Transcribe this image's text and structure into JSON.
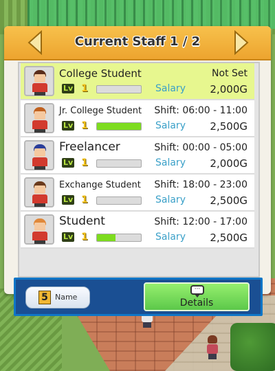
{
  "header": {
    "title": "Current Staff 1 / 2",
    "prev_icon": "arrow-left-icon",
    "next_icon": "arrow-right-icon"
  },
  "labels": {
    "lv": "Lv",
    "salary": "Salary"
  },
  "staff": [
    {
      "name": "College Student",
      "shift": "Not Set",
      "level": "1",
      "progress": 0.0,
      "salary": "2,000G",
      "hair": "#5a2c1a",
      "selected": true
    },
    {
      "name": "Jr. College Student",
      "shift": "Shift: 06:00 - 11:00",
      "level": "1",
      "progress": 1.0,
      "salary": "2,500G",
      "hair": "#c0611f",
      "selected": false
    },
    {
      "name": "Freelancer",
      "shift": "Shift: 00:00 - 05:00",
      "level": "1",
      "progress": 0.0,
      "salary": "2,000G",
      "hair": "#2a3e9a",
      "selected": false
    },
    {
      "name": "Exchange Student",
      "shift": "Shift: 18:00 - 23:00",
      "level": "1",
      "progress": 0.0,
      "salary": "2,500G",
      "hair": "#6a3a1c",
      "selected": false
    },
    {
      "name": "Student",
      "shift": "Shift: 12:00 - 17:00",
      "level": "1",
      "progress": 0.42,
      "salary": "2,500G",
      "hair": "#e0883a",
      "selected": false
    }
  ],
  "footer": {
    "sort_number": "5",
    "sort_label": "Name",
    "details_label": "Details",
    "details_icon": "speech-bubble-icon"
  },
  "colors": {
    "header": "#f0b23d",
    "selected_row": "#e7f78f",
    "footer": "#1a4f93",
    "details_button": "#6fd854",
    "progress_fill": "#7ddc1f",
    "salary_label": "#3aa0c8"
  }
}
